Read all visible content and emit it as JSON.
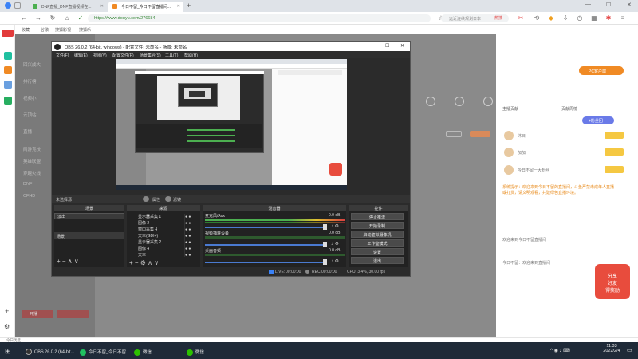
{
  "browser": {
    "tabs": [
      {
        "label": "DNF直播_DNF直播视频在..."
      },
      {
        "label": "今日不留_今日不留直播间..."
      }
    ],
    "new_tab": "+",
    "url": "https://www.douyu.com/276684",
    "search_placeholder": "远近连续规划日本",
    "hot_label": "热搜",
    "bookmarks": {
      "label": "收藏",
      "items": [
        "谷歌",
        "搜狐影视",
        "搜狐乐"
      ]
    }
  },
  "site": {
    "left_nav": [
      "回兴成大",
      "排行榜",
      "视频小"
    ],
    "left_nav_more": [
      "云顶站",
      "直播",
      "网游竞技",
      "英雄联盟",
      "穿越火线",
      "DNF",
      "CFHD"
    ],
    "sidebar_cta": "开播",
    "right_badge": "PC客户端",
    "chat_tabs": [
      "主播贡献",
      "贡献周榜"
    ],
    "chat_button": "+粉丝团",
    "ranks": [
      {
        "name": "沐目"
      },
      {
        "name": "加加"
      },
      {
        "name": "今日不留一大粉丝"
      }
    ],
    "chat_text": "系统提示：欢迎来到今日不留的直播间，斗鱼严禁未成年人直播或打赏，请文明观看，共建绿色直播环境。",
    "chat_msgs": [
      "欢迎来到今日不留直播间",
      "今日不留：欢迎来到直播间"
    ],
    "gift_badge": "分享\n好友\n得奖励"
  },
  "obs": {
    "title": "OBS 26.0.2 (64-bit, windows) - 配置文件: 未命名 - 场景: 未命名",
    "menu": [
      "文件(F)",
      "编辑(E)",
      "视图(V)",
      "配置文件(P)",
      "场景集合(S)",
      "工具(T)",
      "帮助(H)"
    ],
    "no_source": "未选择源",
    "props": "属性",
    "filters": "滤镜",
    "headers": {
      "scenes": "场景",
      "sources": "来源",
      "mixer": "混音器",
      "transitions": "转场特效",
      "controls": "控件"
    },
    "scene_item": "场景",
    "sources": [
      "显示器采集 1",
      "图像 2",
      "窗口采集 4",
      "文本(GDI+)",
      "显示器采集 2",
      "图像 4",
      "文本"
    ],
    "mixer_tracks": [
      {
        "name": "麦克风/Aux",
        "db": "0.0 dB"
      },
      {
        "name": "视频捕获设备",
        "db": "0.0 dB"
      },
      {
        "name": "桌面音频",
        "db": "0.0 dB"
      }
    ],
    "transition_value": "淡出",
    "duration_label": "时长",
    "controls": [
      "停止推流",
      "开始录制",
      "启动虚拟摄像机",
      "工作室模式",
      "设置",
      "退出"
    ],
    "status": {
      "live_label": "LIVE:",
      "live_time": "00:00:00",
      "rec_label": "REC:",
      "rec_time": "00:00:00",
      "cpu": "CPU: 3.4%, 30.00 fps"
    }
  },
  "taskbar": {
    "items": [
      "OBS 26.0.2 (64-bit...",
      "今日不留_今日不留...",
      "微信",
      "微信"
    ],
    "time": "11:33",
    "date": "2022/2/4"
  },
  "bottom_status": "今日优选",
  "colors": {
    "accent": "#f08a24",
    "obs_bg": "#2b2b2b",
    "taskbar": "#1f2a38"
  }
}
